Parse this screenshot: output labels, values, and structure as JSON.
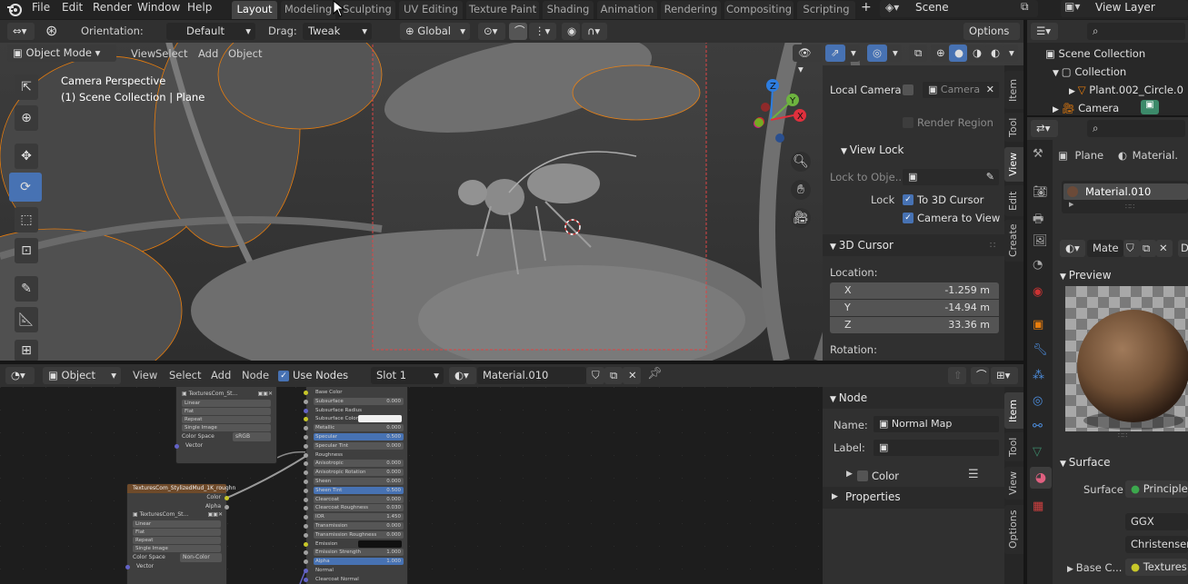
{
  "menubar": {
    "items": [
      "File",
      "Edit",
      "Render",
      "Window",
      "Help"
    ],
    "tabs": [
      "Layout",
      "Modeling",
      "Sculpting",
      "UV Editing",
      "Texture Paint",
      "Shading",
      "Animation",
      "Rendering",
      "Compositing",
      "Scripting"
    ],
    "add_tab": "+",
    "scene_label": "Scene",
    "view_layer_label": "View Layer"
  },
  "viewport_header": {
    "orientation_label": "Orientation:",
    "orientation_value": "Default",
    "drag_label": "Drag:",
    "drag_value": "Tweak",
    "transform_space": "Global",
    "options_label": "Options",
    "mode": "Object Mode",
    "menu": [
      "View",
      "Select",
      "Add",
      "Object"
    ]
  },
  "viewport": {
    "camera_title": "Camera Perspective",
    "collection_info": "(1) Scene Collection | Plane",
    "gizmo": {
      "z": "Z",
      "y": "Y",
      "x": "X"
    }
  },
  "sidebar_view": {
    "tabs": [
      "Item",
      "Tool",
      "View",
      "Edit",
      "Create"
    ],
    "local_camera_label": "Local Camera",
    "local_camera_value": "Camera",
    "render_region_label": "Render Region",
    "view_lock_header": "View Lock",
    "lock_to_object_label": "Lock to Obje...",
    "lock_label": "Lock",
    "to_3d_cursor": "To 3D Cursor",
    "camera_to_view": "Camera to View",
    "cursor_header": "3D Cursor",
    "location_label": "Location:",
    "x_label": "X",
    "x_value": "-1.259 m",
    "y_label": "Y",
    "y_value": "-14.94 m",
    "z_label": "Z",
    "z_value": "33.36 m",
    "rotation_label": "Rotation:"
  },
  "node_editor_header": {
    "object_type": "Object",
    "menu": [
      "View",
      "Select",
      "Add",
      "Node"
    ],
    "use_nodes_label": "Use Nodes",
    "slot": "Slot 1",
    "material": "Material.010"
  },
  "node_sidebar": {
    "tabs": [
      "Item",
      "Tool",
      "View",
      "Options"
    ],
    "node_header": "Node",
    "name_label": "Name:",
    "name_value": "Normal Map",
    "label_label": "Label:",
    "color_label": "Color",
    "properties_label": "Properties"
  },
  "nodes": {
    "tex1": {
      "image": "TexturesCom_St...",
      "rows": [
        "Linear",
        "Flat",
        "Repeat",
        "Single Image"
      ],
      "colorspace_label": "Color Space",
      "colorspace_value": "sRGB",
      "vector": "Vector"
    },
    "tex2": {
      "title": "TexturesCom_StylizedMud_1K_roughn",
      "color": "Color",
      "alpha": "Alpha",
      "image": "TexturesCom_St...",
      "rows": [
        "Linear",
        "Flat",
        "Repeat",
        "Single Image"
      ],
      "colorspace_label": "Color Space",
      "colorspace_value": "Non-Color",
      "vector": "Vector"
    },
    "bsdf": [
      {
        "label": "Base Color",
        "value": ""
      },
      {
        "label": "Subsurface",
        "value": "0.000"
      },
      {
        "label": "Subsurface Radius",
        "value": ""
      },
      {
        "label": "Subsurface Color",
        "value": ""
      },
      {
        "label": "Metallic",
        "value": "0.000"
      },
      {
        "label": "Specular",
        "value": "0.500"
      },
      {
        "label": "Specular Tint",
        "value": "0.000"
      },
      {
        "label": "Roughness",
        "value": ""
      },
      {
        "label": "Anisotropic",
        "value": "0.000"
      },
      {
        "label": "Anisotropic Rotation",
        "value": "0.000"
      },
      {
        "label": "Sheen",
        "value": "0.000"
      },
      {
        "label": "Sheen Tint",
        "value": "0.500"
      },
      {
        "label": "Clearcoat",
        "value": "0.000"
      },
      {
        "label": "Clearcoat Roughness",
        "value": "0.030"
      },
      {
        "label": "IOR",
        "value": "1.450"
      },
      {
        "label": "Transmission",
        "value": "0.000"
      },
      {
        "label": "Transmission Roughness",
        "value": "0.000"
      },
      {
        "label": "Emission",
        "value": ""
      },
      {
        "label": "Emission Strength",
        "value": "1.000"
      },
      {
        "label": "Alpha",
        "value": "1.000"
      },
      {
        "label": "Normal",
        "value": ""
      },
      {
        "label": "Clearcoat Normal",
        "value": ""
      }
    ]
  },
  "outliner": {
    "scene_collection": "Scene Collection",
    "collection": "Collection",
    "plant": "Plant.002_Circle.0",
    "camera": "Camera"
  },
  "properties": {
    "object_name": "Plane",
    "material_short": "Material.",
    "slot_material": "Material.010",
    "mat_field": "Mate",
    "preview_header": "Preview",
    "surface_header": "Surface",
    "surface_label": "Surface",
    "surface_value": "Principled",
    "distribution": "GGX",
    "subsurface_method": "Christensen",
    "base_color_label": "Base C...",
    "base_color_value": "Textures"
  },
  "colors": {
    "accent_blue": "#4772b3",
    "selection_orange": "#e87d0d",
    "active_tab": "#454545",
    "panel_bg": "#303030"
  }
}
